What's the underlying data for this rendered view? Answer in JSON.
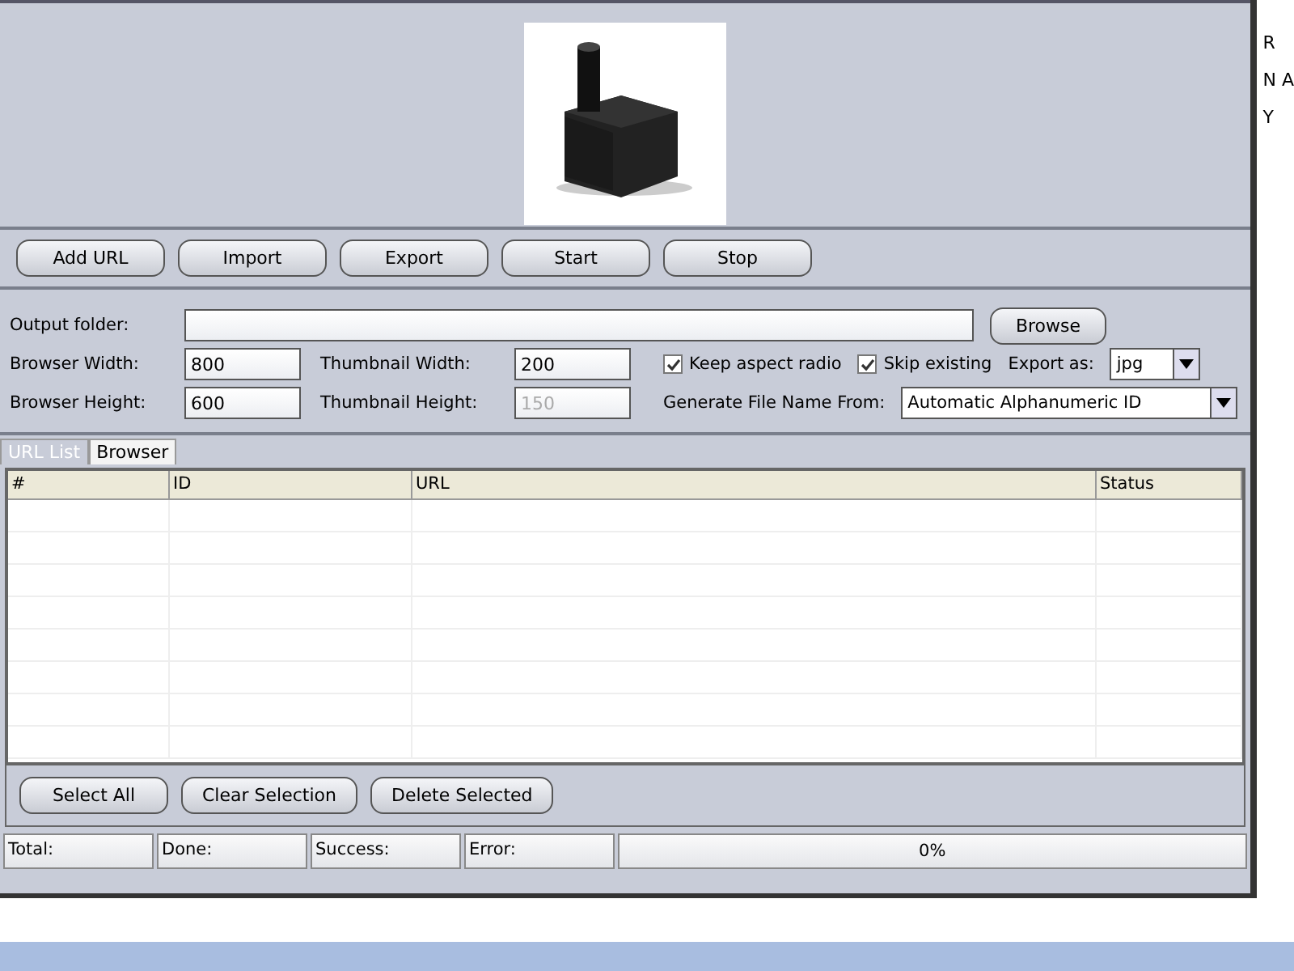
{
  "preview": {
    "kind": "picture"
  },
  "toolbar": [
    "Add URL",
    "Import",
    "Export",
    "Start",
    "Stop"
  ],
  "settings": {
    "output_folder": {
      "label": "Output folder:"
    },
    "browse": "Browse",
    "browser_width": {
      "label": "Browser Width:",
      "value": "800"
    },
    "browser_height": {
      "label": "Browser Height:",
      "value": "600"
    },
    "thumb_width": {
      "label": "Thumbnail Width:",
      "value": "200",
      "disabled": false
    },
    "thumb_height": {
      "label": "Thumbnail Height:",
      "value": "150",
      "disabled": true
    },
    "checks": [
      {
        "label": "Keep aspect radio",
        "checked": true
      },
      {
        "label": "Skip existing",
        "checked": true
      }
    ],
    "export_as": {
      "label": "Export as:",
      "value": "jpg"
    },
    "file_name": {
      "label": "Generate File Name From:",
      "value": "Automatic Alphanumeric ID"
    }
  },
  "tabs": [
    {
      "label": "URL List",
      "selected": true
    },
    {
      "label": "Browser",
      "selected": false
    }
  ],
  "table": {
    "columns": [
      "#",
      "ID",
      "URL",
      "Status"
    ]
  },
  "bottom_buttons": [
    "Select All",
    "Clear Selection",
    "Delete Selected"
  ],
  "status_bar": {
    "fields": [
      "Total:",
      "Done:",
      "Success:",
      "Error:"
    ],
    "progress": {
      "level": 0,
      "reading": "0%"
    }
  },
  "background": {
    "texts": [
      "R",
      "N A",
      "Y"
    ]
  }
}
